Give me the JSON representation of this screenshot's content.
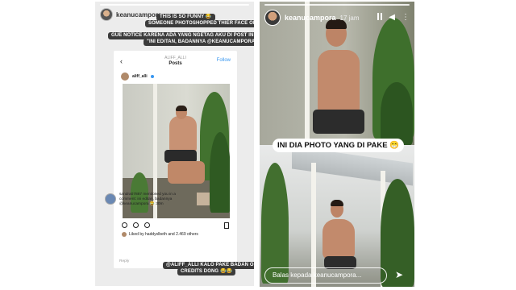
{
  "left_story": {
    "username": "keanucampora",
    "captions": [
      "THIS IS SO FUNNY 😂",
      "SOMEONE PHOTOSHOPPED THIER FACE ON MY BODY!",
      "GUE NOTICE KARENA ADA YANG NGETAG AKU DI POST INI 😂 SAYING",
      "\"INI EDITAN, BADANNYA @KEANUCAMPORA\""
    ],
    "post": {
      "header_username": "ALIFF_ALLI",
      "header_title": "Posts",
      "follow_label": "Follow",
      "poster_name": "aliff_alli",
      "likes_text": "Liked by haddyslbeth and 2.469 others",
      "notification_text": "sandra07887 mentioned you in a comment: ini editan, badannya @keanucampora 😂 30m",
      "reply_label": "Reply"
    },
    "bottom_captions": [
      "@ALIFF_ALLI KALO PAKE BADAN ORANG HARUS",
      "CREDITS DONG 😂😂"
    ]
  },
  "right_story": {
    "username": "keanucampora",
    "time": "17 jam",
    "caption": "INI DIA PHOTO YANG DI PAKE 😁",
    "reply_placeholder": "Balas kepada keanucampora..."
  },
  "icons": {
    "left_back": "chevron-left-icon",
    "heart": "heart-icon",
    "comment": "comment-icon",
    "share": "send-icon",
    "bookmark": "bookmark-icon",
    "pause": "pause-icon",
    "sound": "speaker-icon",
    "more": "more-icon",
    "send": "paper-plane-icon"
  }
}
